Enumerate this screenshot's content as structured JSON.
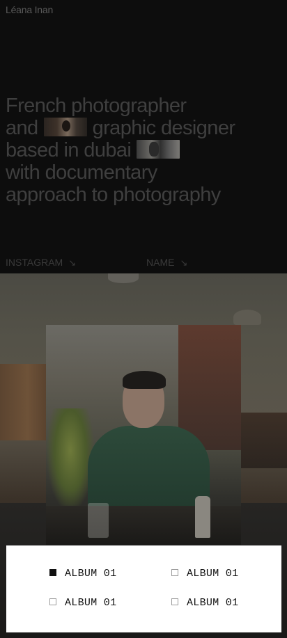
{
  "brand": "Léana Inan",
  "hero": {
    "line1": "French photographer",
    "line2a": "and",
    "line2b": "graphic designer",
    "line3": "based in dubai",
    "line4": "with documentary",
    "line5": "approach to photography"
  },
  "links": [
    {
      "label": "INSTAGRAM",
      "icon": "arrow-down-right-icon"
    },
    {
      "label": "NAME",
      "icon": "arrow-down-right-icon"
    }
  ],
  "albums": [
    {
      "label": "ALBUM 01",
      "selected": true
    },
    {
      "label": "ALBUM 01",
      "selected": false
    },
    {
      "label": "ALBUM 01",
      "selected": false
    },
    {
      "label": "ALBUM 01",
      "selected": false
    }
  ],
  "colors": {
    "background": "#0d0d0d",
    "text_dim": "#3f3f3f",
    "panel": "#ffffff",
    "panel_text": "#111111"
  }
}
